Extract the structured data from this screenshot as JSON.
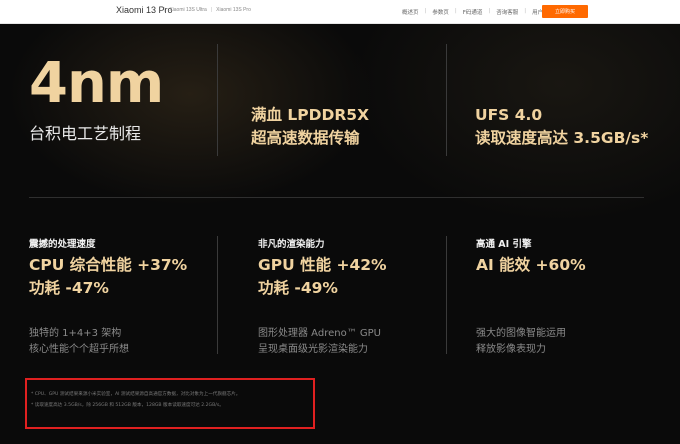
{
  "nav": {
    "product_name": "Xiaomi 13 Pro",
    "variants": [
      "Xiaomi 13S Ultra",
      "Xiaomi 13S Pro"
    ],
    "links": [
      "概述页",
      "参数页",
      "F码通道",
      "咨询客服",
      "用户评价"
    ],
    "buy_label": "立即购买",
    "accent_color": "#ff6900"
  },
  "hero": {
    "process": {
      "big": "4nm",
      "label": "台积电工艺制程"
    },
    "memory": {
      "line1": "满血 LPDDR5X",
      "line2": "超高速数据传输"
    },
    "storage": {
      "line1": "UFS 4.0",
      "line2": "读取速度高达 3.5GB/s*"
    },
    "features": [
      {
        "title": "震撼的处理速度",
        "main1": "CPU 综合性能 +37%",
        "main2": "功耗 -47%",
        "desc1": "独特的 1+4+3 架构",
        "desc2": "核心性能个个超乎所想"
      },
      {
        "title": "非凡的渲染能力",
        "main1": "GPU 性能 +42%",
        "main2": "功耗 -49%",
        "desc1": "图形处理器  Adreno™ GPU",
        "desc2": "呈现桌面级光影渲染能力"
      },
      {
        "title": "高通 AI 引擎",
        "main1": "AI 能效 +60%",
        "desc1": "强大的图像智能运用",
        "desc2": "释放影像表现力"
      }
    ],
    "footnotes": [
      "* CPU、GPU 测试结果来源小米实验室，AI 测试结果源自高通官方数据，对比对象为上一代旗舰芯片。",
      "* 读取速度高达 3.5GB/s，除 256GB 和 512GB 版本，128GB 版本读取速度可达 2.2GB/s。"
    ],
    "gold_color": "#f0d3a0",
    "highlight_border_color": "#e02020"
  }
}
